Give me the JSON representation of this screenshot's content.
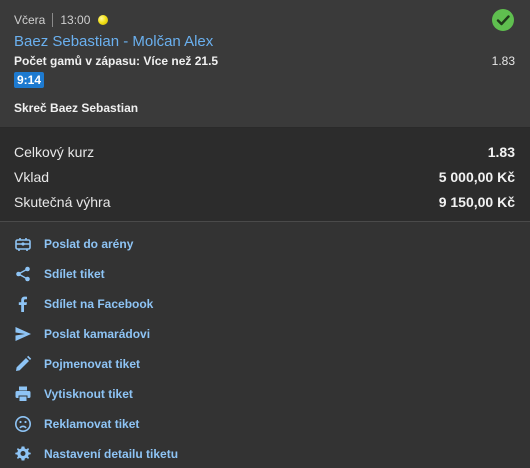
{
  "bet": {
    "day": "Včera",
    "time": "13:00",
    "status_icon": "check-circle-icon",
    "match": "Baez Sebastian - Molčan Alex",
    "market": "Počet gamů v zápasu: Více než 21.5",
    "odd": "1.83",
    "score_time": "9:14",
    "note": "Skreč Baez Sebastian"
  },
  "summary": {
    "total_odd_label": "Celkový kurz",
    "total_odd_value": "1.83",
    "stake_label": "Vklad",
    "stake_value": "5 000,00 Kč",
    "win_label": "Skutečná výhra",
    "win_value": "9 150,00 Kč"
  },
  "actions": [
    {
      "label": "Poslat do arény",
      "icon": "arena-icon"
    },
    {
      "label": "Sdílet tiket",
      "icon": "share-icon"
    },
    {
      "label": "Sdílet na Facebook",
      "icon": "facebook-icon"
    },
    {
      "label": "Poslat kamarádovi",
      "icon": "send-icon"
    },
    {
      "label": "Pojmenovat tiket",
      "icon": "pencil-icon"
    },
    {
      "label": "Vytisknout tiket",
      "icon": "printer-icon"
    },
    {
      "label": "Reklamovat tiket",
      "icon": "sad-face-icon"
    },
    {
      "label": "Nastavení detailu tiketu",
      "icon": "gear-icon"
    }
  ],
  "colors": {
    "link": "#8ec4f5",
    "match": "#6ab0ef",
    "success": "#5fbf4f",
    "live_badge": "#1d7ad0"
  }
}
